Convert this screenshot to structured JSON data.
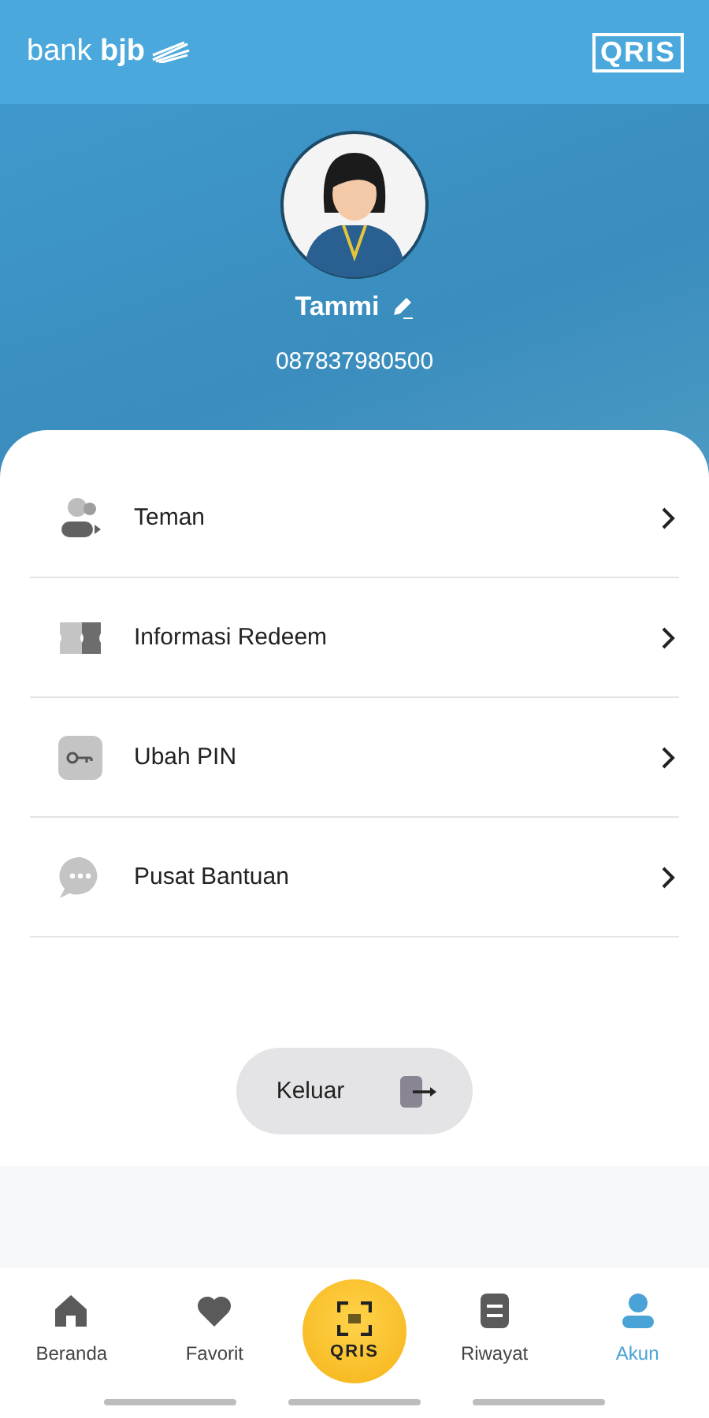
{
  "header": {
    "logo": "bank **bjb**",
    "qris_logo": "QRIS"
  },
  "profile": {
    "name": "Tammi",
    "phone": "087837980500"
  },
  "menu": [
    {
      "kind": "friends",
      "label": "Teman"
    },
    {
      "kind": "redeem",
      "label": "Informasi Redeem"
    },
    {
      "kind": "pin",
      "label": "Ubah PIN"
    },
    {
      "kind": "help",
      "label": "Pusat Bantuan"
    }
  ],
  "logout": {
    "label": "Keluar"
  },
  "nav": [
    {
      "kind": "home",
      "label": "Beranda",
      "selected": false
    },
    {
      "kind": "heart",
      "label": "Favorit",
      "selected": false
    },
    {
      "kind": "qris",
      "label": "QRIS",
      "selected": false
    },
    {
      "kind": "history",
      "label": "Riwayat",
      "selected": false
    },
    {
      "kind": "account",
      "label": "Akun",
      "selected": true
    }
  ]
}
